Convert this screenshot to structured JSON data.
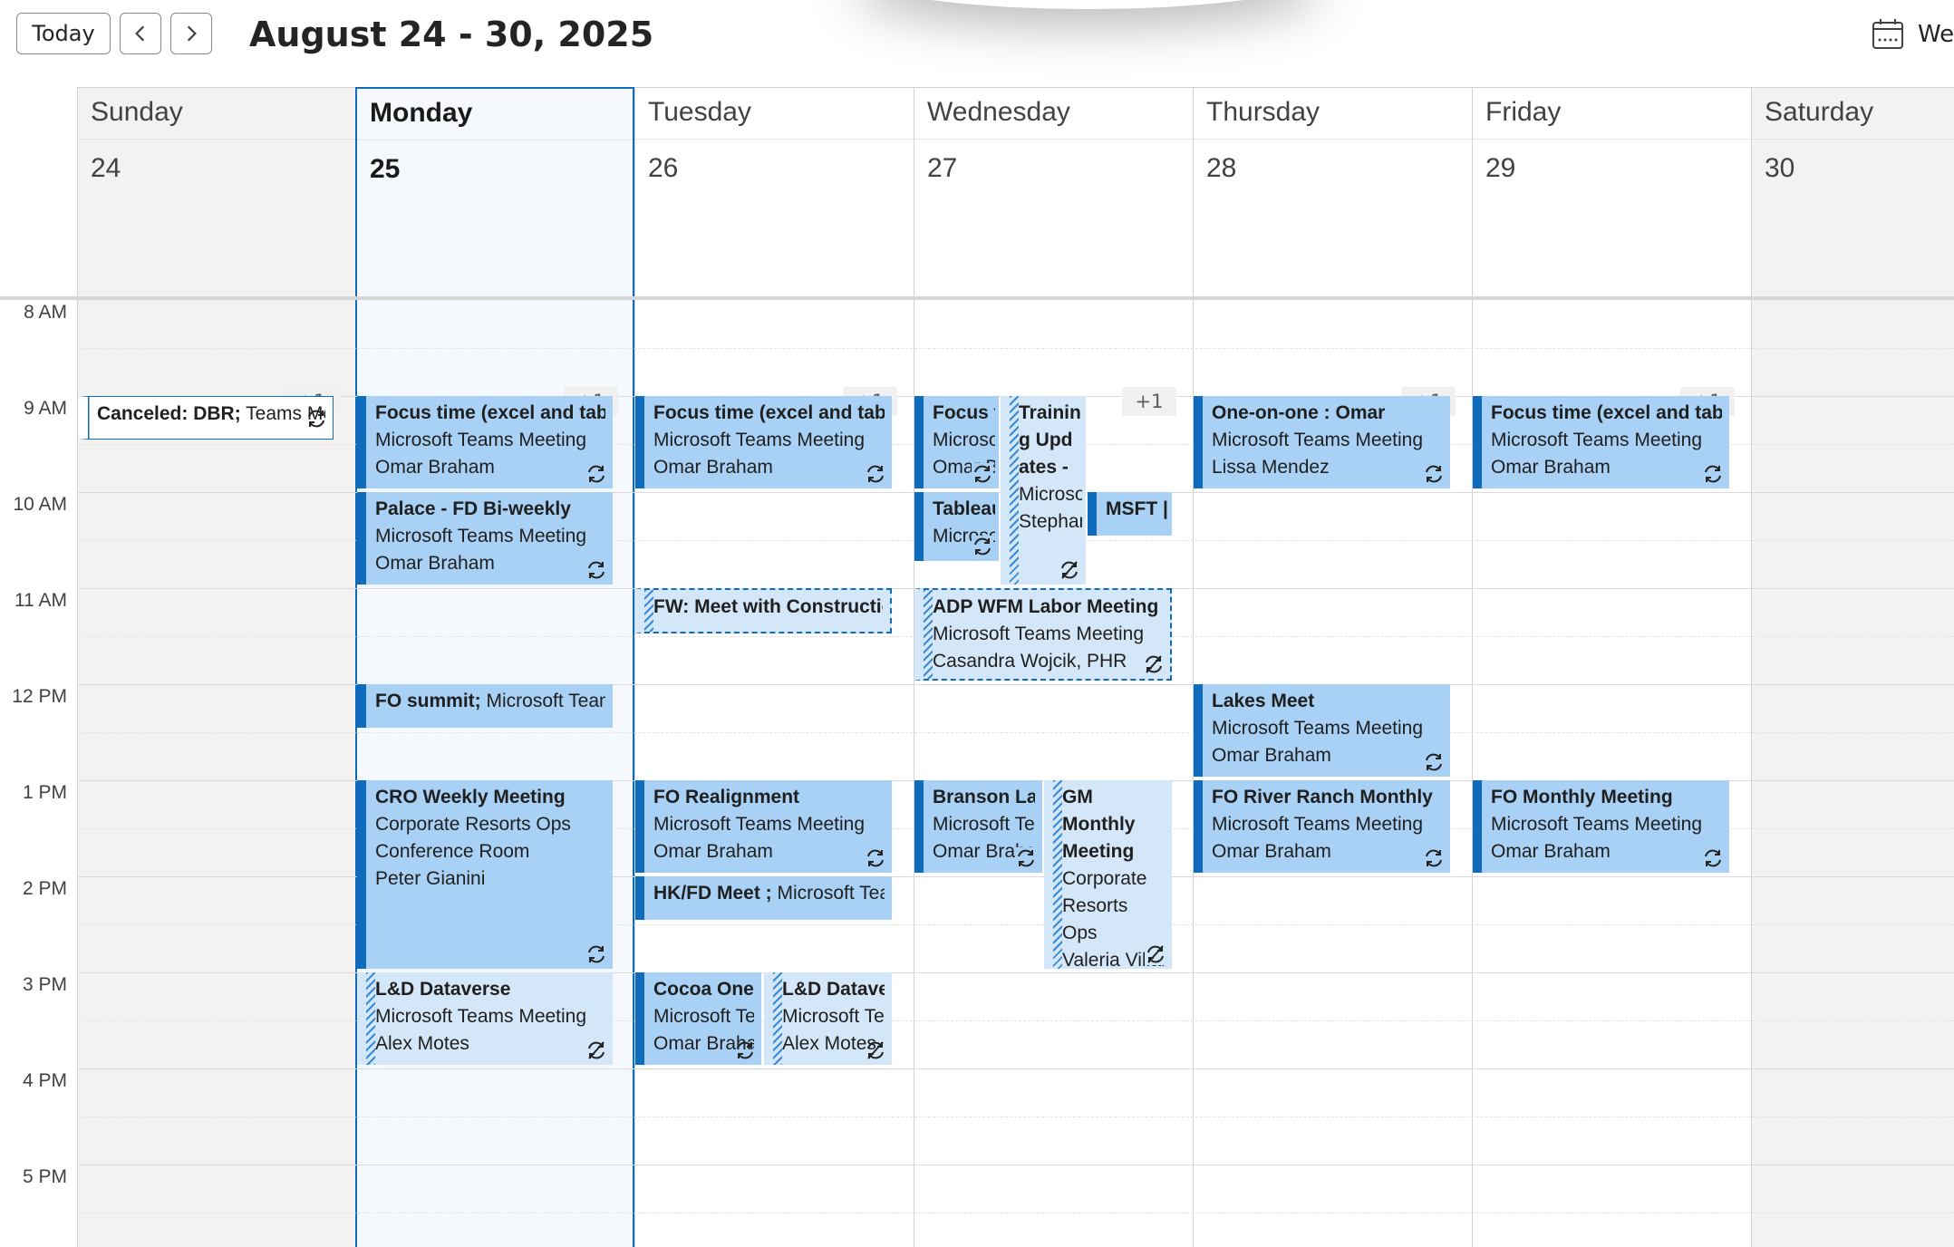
{
  "toolbar": {
    "today_label": "Today",
    "range_title": "August 24 - 30, 2025",
    "view_label": "We"
  },
  "days": [
    {
      "name": "Sunday",
      "num": "24"
    },
    {
      "name": "Monday",
      "num": "25"
    },
    {
      "name": "Tuesday",
      "num": "26"
    },
    {
      "name": "Wednesday",
      "num": "27"
    },
    {
      "name": "Thursday",
      "num": "28"
    },
    {
      "name": "Friday",
      "num": "29"
    },
    {
      "name": "Saturday",
      "num": "30"
    }
  ],
  "hours": [
    "8 AM",
    "9 AM",
    "10 AM",
    "11 AM",
    "12 PM",
    "1 PM",
    "2 PM",
    "3 PM",
    "4 PM",
    "5 PM"
  ],
  "more_label": "+1",
  "events": {
    "sun_cancel": {
      "title": "Canceled: DBR;",
      "rest": " Teams Meeting"
    },
    "mon_focus": {
      "title": "Focus time (excel and table)",
      "line1": "Microsoft Teams Meeting",
      "line2": "Omar Braham"
    },
    "mon_palace": {
      "title": "Palace - FD Bi-weekly",
      "line1": "Microsoft Teams Meeting",
      "line2": "Omar Braham"
    },
    "mon_fo_summit": {
      "title": "FO summit;",
      "rest": " Microsoft Teams Meeting"
    },
    "mon_cro": {
      "title": "CRO Weekly Meeting",
      "line1": "Corporate Resorts Ops",
      "line2": "Conference Room",
      "line3": "Peter Gianini"
    },
    "mon_ld": {
      "title": "L&D Dataverse",
      "line1": "Microsoft Teams Meeting",
      "line2": "Alex Motes"
    },
    "tue_focus": {
      "title": "Focus time (excel and table)",
      "line1": "Microsoft Teams Meeting",
      "line2": "Omar Braham"
    },
    "tue_fw": {
      "title": "FW: Meet with Construction"
    },
    "tue_fo_realign": {
      "title": "FO Realignment",
      "line1": "Microsoft Teams Meeting",
      "line2": "Omar Braham"
    },
    "tue_hkfd": {
      "title": "HK/FD Meet ;",
      "rest": " Microsoft Teams Meeting"
    },
    "tue_cocoa": {
      "title": "Cocoa One",
      "line1": "Microsoft Teams Meeting",
      "line2": "Omar Braham"
    },
    "tue_ld": {
      "title": "L&D Dataverse",
      "line1": "Microsoft Teams Meeting",
      "line2": "Alex Motes"
    },
    "wed_focus": {
      "title": "Focus time",
      "line1": "Microsoft Teams Meeting",
      "line2": "Omar Braham"
    },
    "wed_training": {
      "title": "Training Updates -",
      "line1": "Microsoft Teams Meeting",
      "line2": "Stephanie"
    },
    "wed_tableau": {
      "title": "Tableau",
      "line1": "Microsoft Teams Meeting"
    },
    "wed_msft": {
      "title": "MSFT |"
    },
    "wed_adp": {
      "title": "ADP WFM Labor Meeting",
      "line1": "Microsoft Teams Meeting",
      "line2": "Casandra Wojcik, PHR"
    },
    "wed_branson": {
      "title": "Branson Lakes",
      "line1": "Microsoft Teams Meeting",
      "line2": "Omar Braham"
    },
    "wed_gm": {
      "title": "GM Monthly Meeting",
      "line1": "Corporate Resorts Ops",
      "line2": "Valeria Villarreal"
    },
    "thu_oneonone": {
      "title": "One-on-one : Omar",
      "line1": "Microsoft Teams Meeting",
      "line2": "Lissa Mendez"
    },
    "thu_lakes": {
      "title": "Lakes Meet",
      "line1": "Microsoft Teams Meeting",
      "line2": "Omar Braham"
    },
    "thu_fo_river": {
      "title": "FO River Ranch Monthly",
      "line1": "Microsoft Teams Meeting",
      "line2": "Omar Braham"
    },
    "fri_focus": {
      "title": "Focus time (excel and table)",
      "line1": "Microsoft Teams Meeting",
      "line2": "Omar Braham"
    },
    "fri_fo_monthly": {
      "title": "FO Monthly Meeting",
      "line1": "Microsoft Teams Meeting",
      "line2": "Omar Braham"
    }
  },
  "colors": {
    "accent": "#0f6cbd",
    "event_fill": "#a8d1f5",
    "tentative_fill": "#d4e7f9",
    "weekend_bg": "#f3f2f1",
    "today_bg": "#f5f9fd"
  },
  "icons": {
    "recurring": "recurring-icon",
    "exception": "recurring-exception-icon",
    "calendar": "calendar-view-icon"
  }
}
